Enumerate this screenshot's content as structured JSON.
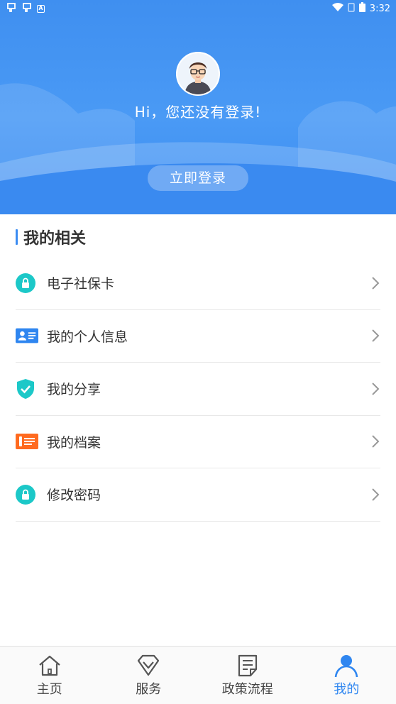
{
  "status_bar": {
    "left_icons": [
      "bug-icon",
      "bug-icon",
      "a-box-icon"
    ],
    "time": "3:32"
  },
  "header": {
    "greeting": "Hi，您还没有登录!",
    "login_button": "立即登录"
  },
  "section": {
    "title": "我的相关"
  },
  "menu": {
    "items": [
      {
        "label": "电子社保卡",
        "icon": "lock-circle-icon"
      },
      {
        "label": "我的个人信息",
        "icon": "id-card-icon"
      },
      {
        "label": "我的分享",
        "icon": "shield-check-icon"
      },
      {
        "label": "我的档案",
        "icon": "archive-card-icon"
      },
      {
        "label": "修改密码",
        "icon": "lock-circle-icon"
      }
    ]
  },
  "bottom_nav": {
    "items": [
      {
        "label": "主页",
        "icon": "home-icon",
        "active": false
      },
      {
        "label": "服务",
        "icon": "diamond-icon",
        "active": false
      },
      {
        "label": "政策流程",
        "icon": "document-icon",
        "active": false
      },
      {
        "label": "我的",
        "icon": "user-icon",
        "active": true
      }
    ]
  },
  "colors": {
    "primary": "#3b8cf2",
    "teal": "#1cc8c8",
    "orange": "#ff6a1f"
  }
}
